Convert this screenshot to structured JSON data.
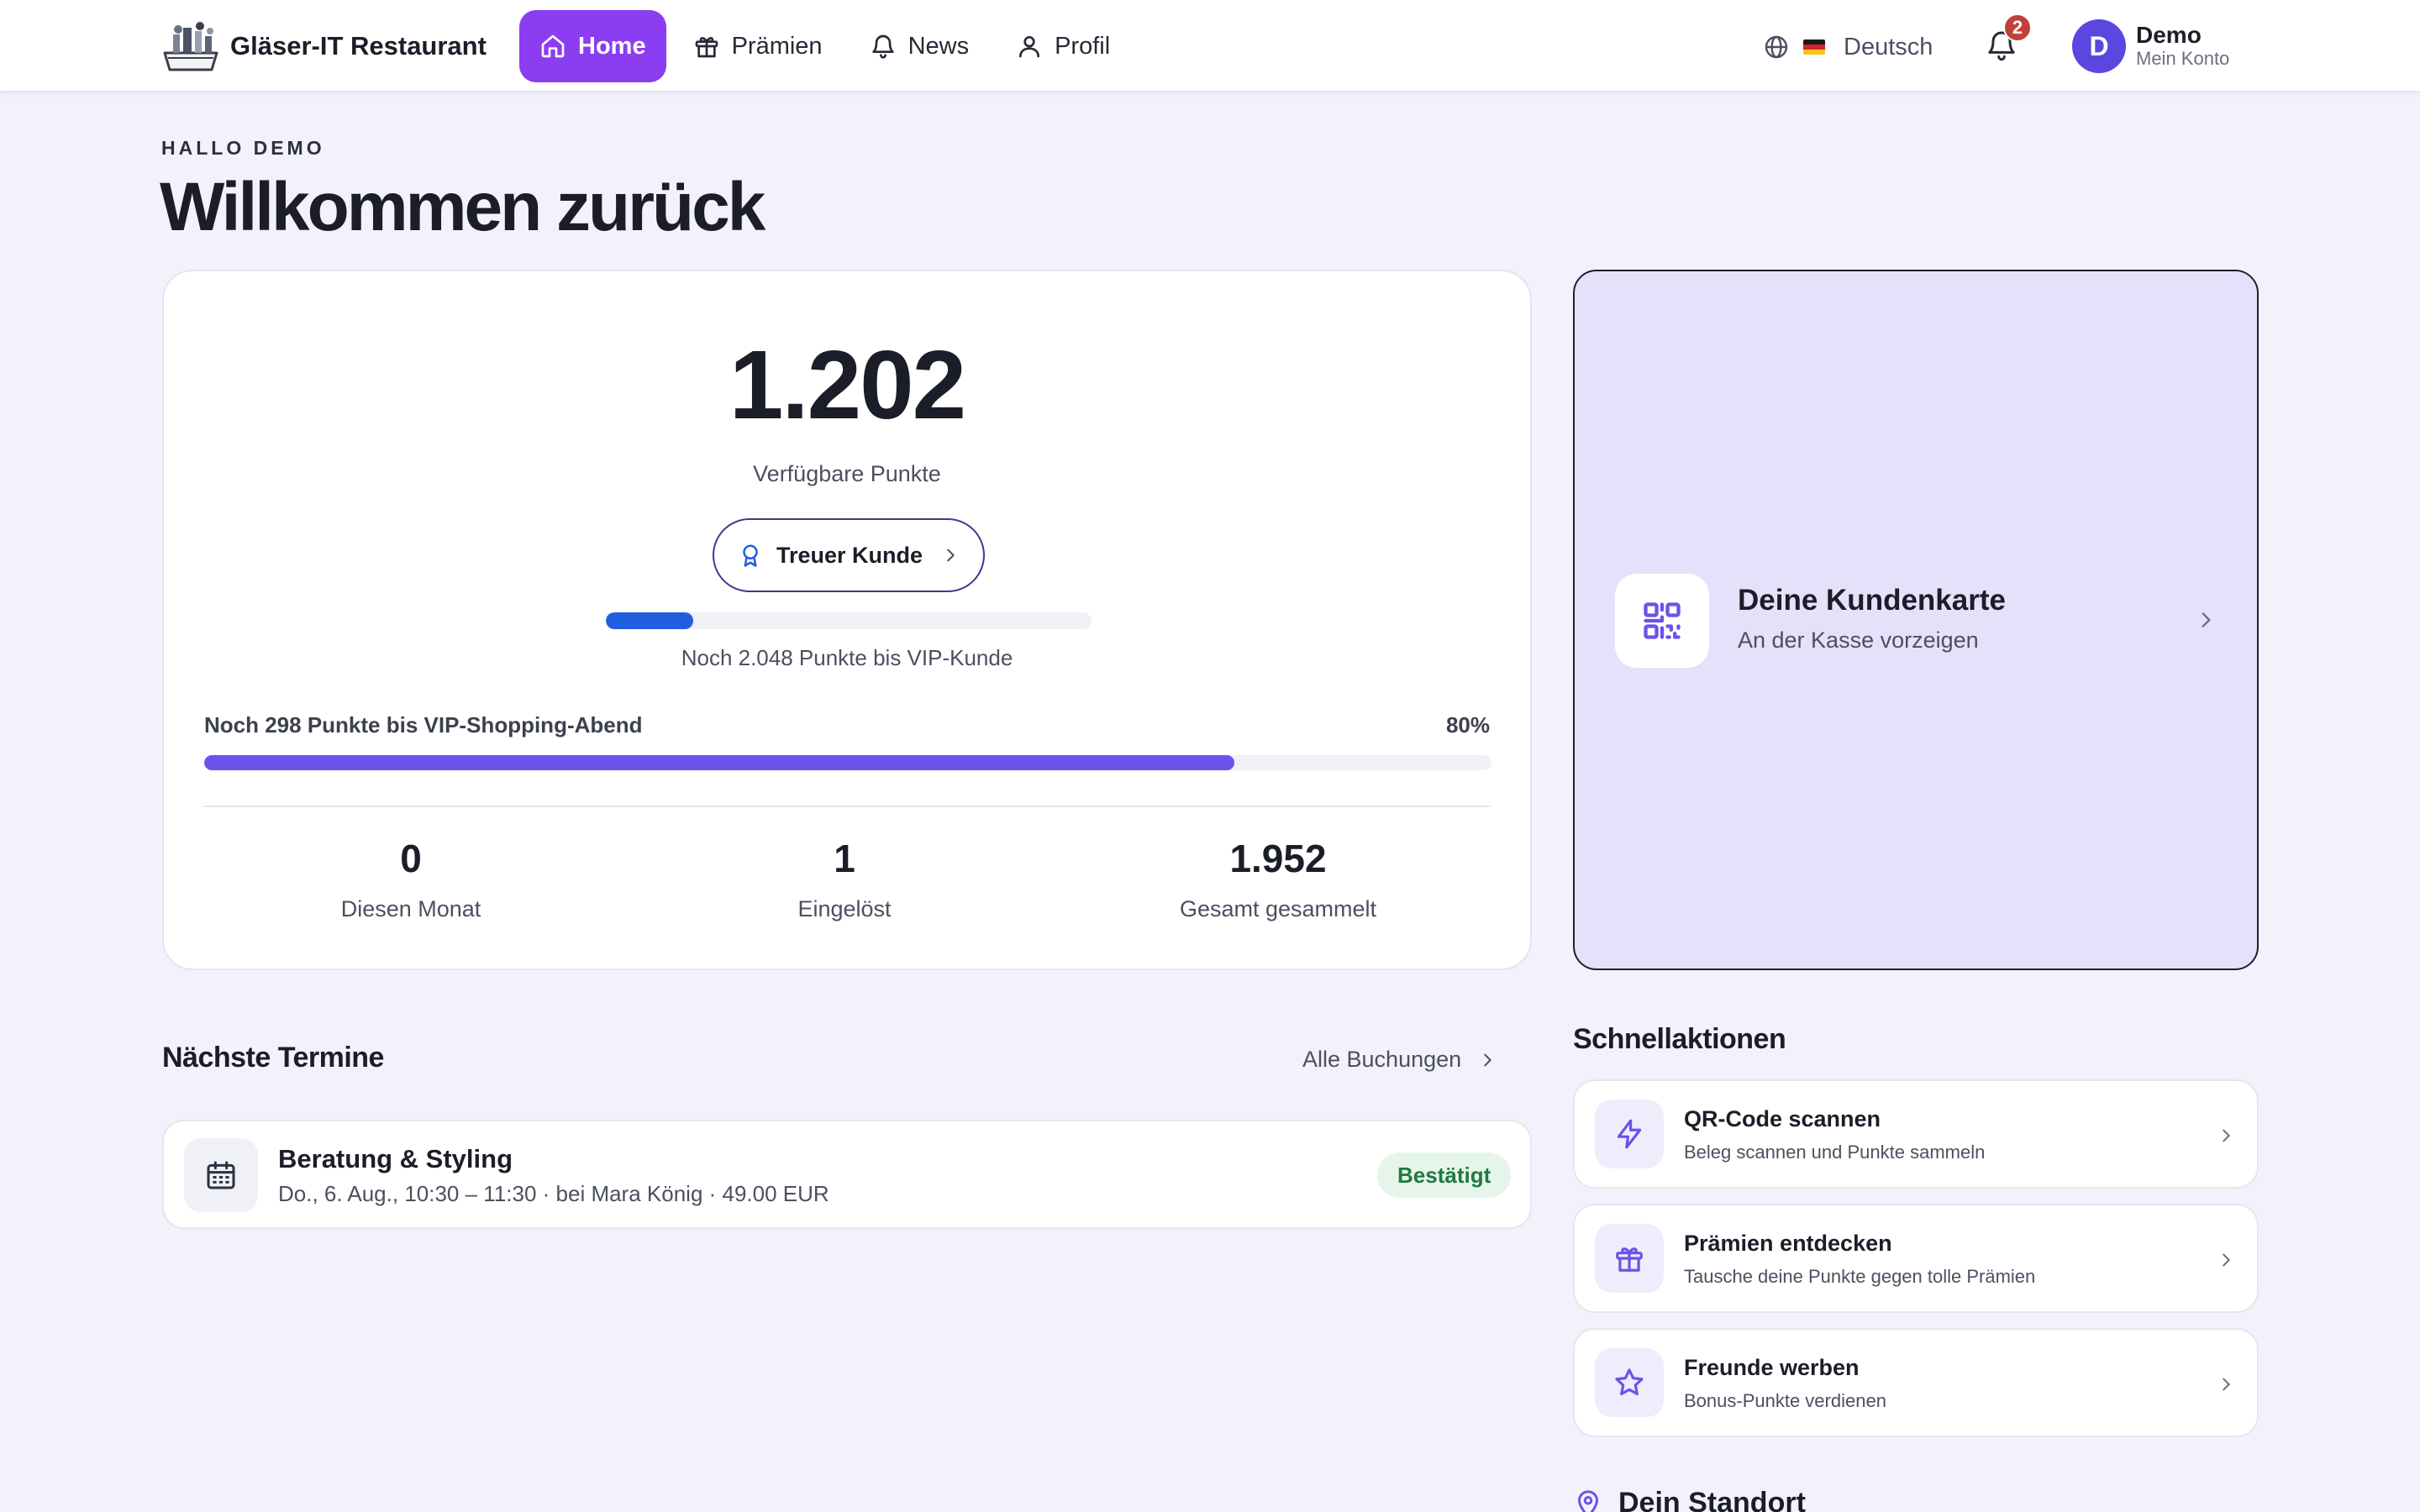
{
  "brand": {
    "name": "Gläser-IT Restaurant"
  },
  "nav": [
    {
      "label": "Home",
      "icon": "home-icon",
      "active": true
    },
    {
      "label": "Prämien",
      "icon": "gift-icon",
      "active": false
    },
    {
      "label": "News",
      "icon": "bell-icon",
      "active": false
    },
    {
      "label": "Profil",
      "icon": "user-icon",
      "active": false
    }
  ],
  "header": {
    "language": "Deutsch",
    "notification_count": "2",
    "user": {
      "initial": "D",
      "name": "Demo",
      "subtitle": "Mein Konto"
    }
  },
  "greeting": {
    "eyebrow": "HALLO DEMO",
    "title": "Willkommen zurück"
  },
  "points": {
    "value": "1.202",
    "label": "Verfügbare Punkte",
    "tier_label": "Treuer Kunde",
    "tier_progress": 0.18,
    "tier_caption": "Noch 2.048 Punkte bis VIP-Kunde",
    "goal_label": "Noch 298 Punkte bis VIP-Shopping-Abend",
    "goal_percent_text": "80%",
    "goal_progress": 0.8,
    "stats": [
      {
        "value": "0",
        "label": "Diesen Monat"
      },
      {
        "value": "1",
        "label": "Eingelöst"
      },
      {
        "value": "1.952",
        "label": "Gesamt gesammelt"
      }
    ]
  },
  "customer_card": {
    "title": "Deine Kundenkarte",
    "subtitle": "An der Kasse vorzeigen"
  },
  "appointments": {
    "title": "Nächste Termine",
    "all_link": "Alle Buchungen",
    "items": [
      {
        "title": "Beratung & Styling",
        "details": "Do., 6. Aug., 10:30 – 11:30 · bei Mara König · 49.00 EUR",
        "status": "Bestätigt"
      }
    ]
  },
  "quick_actions": {
    "title": "Schnellaktionen",
    "items": [
      {
        "title": "QR-Code scannen",
        "subtitle": "Beleg scannen und Punkte sammeln",
        "icon": "lightning-icon"
      },
      {
        "title": "Prämien entdecken",
        "subtitle": "Tausche deine Punkte gegen tolle Prämien",
        "icon": "gift-icon"
      },
      {
        "title": "Freunde werben",
        "subtitle": "Bonus-Punkte verdienen",
        "icon": "star-icon"
      }
    ]
  },
  "location": {
    "title": "Dein Standort"
  },
  "colors": {
    "accent": "#8b3df1",
    "primary_progress": "#6b52ea",
    "tier_progress": "#1f5ee0",
    "success": "#1f7a3f",
    "badge": "#c2403a"
  }
}
